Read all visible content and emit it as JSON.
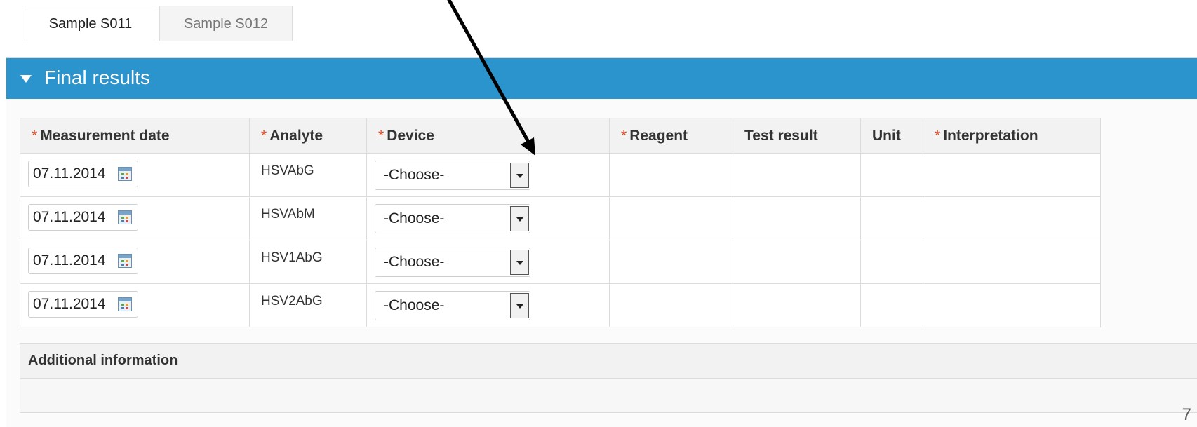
{
  "tabs": [
    {
      "label": "Sample S011",
      "active": true
    },
    {
      "label": "Sample S012",
      "active": false
    }
  ],
  "panel": {
    "title": "Final results",
    "header_color": "#2b94cd"
  },
  "table": {
    "required_marker": "*",
    "required_color": "#e0441f",
    "columns": [
      {
        "label": "Measurement date",
        "required": true
      },
      {
        "label": "Analyte",
        "required": true
      },
      {
        "label": "Device",
        "required": true
      },
      {
        "label": "Reagent",
        "required": true
      },
      {
        "label": "Test result",
        "required": false
      },
      {
        "label": "Unit",
        "required": false
      },
      {
        "label": "Interpretation",
        "required": true
      }
    ],
    "rows": [
      {
        "date": "07.11.2014",
        "analyte": "HSVAbG",
        "device": "-Choose-"
      },
      {
        "date": "07.11.2014",
        "analyte": "HSVAbM",
        "device": "-Choose-"
      },
      {
        "date": "07.11.2014",
        "analyte": "HSV1AbG",
        "device": "-Choose-"
      },
      {
        "date": "07.11.2014",
        "analyte": "HSV2AbG",
        "device": "-Choose-"
      }
    ]
  },
  "additional_info": {
    "label": "Additional information"
  },
  "icons": {
    "calendar": "calendar-icon",
    "dropdown": "chevron-down-icon",
    "collapse": "caret-down-icon",
    "annotation": "annotation-arrow"
  },
  "page_number": "7"
}
